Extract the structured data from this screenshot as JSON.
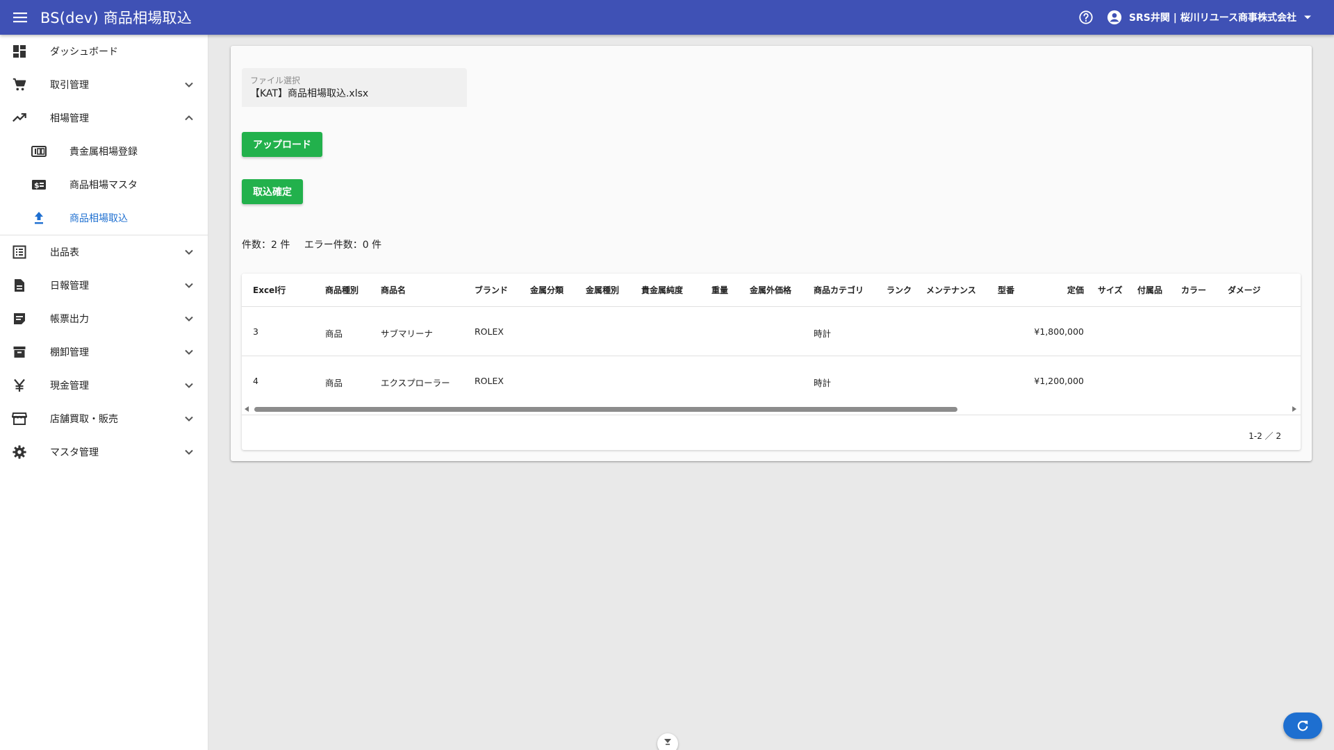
{
  "app": {
    "title": "BS(dev) 商品相場取込",
    "user": "SRS井関 | 桜川リユース商事株式会社",
    "colors": {
      "appbar": "#3f51b5",
      "accent_green": "#22b14c",
      "active_blue": "#1e6fd0"
    }
  },
  "sidebar": {
    "items": [
      {
        "label": "ダッシュボード",
        "icon": "dashboard-icon"
      },
      {
        "label": "取引管理",
        "icon": "cart-icon"
      },
      {
        "label": "相場管理",
        "icon": "trending-up-icon"
      },
      {
        "label": "出品表",
        "icon": "list-icon"
      },
      {
        "label": "日報管理",
        "icon": "document-icon"
      },
      {
        "label": "帳票出力",
        "icon": "report-icon"
      },
      {
        "label": "棚卸管理",
        "icon": "archive-icon"
      },
      {
        "label": "現金管理",
        "icon": "yen-icon"
      },
      {
        "label": "店舗買取・販売",
        "icon": "store-icon"
      },
      {
        "label": "マスタ管理",
        "icon": "gear-icon"
      }
    ],
    "sub_items": [
      {
        "label": "貴金属相場登録",
        "icon": "counter-100-icon"
      },
      {
        "label": "商品相場マスタ",
        "icon": "price-tag-icon"
      },
      {
        "label": "商品相場取込",
        "icon": "upload-icon"
      }
    ]
  },
  "main": {
    "file_label": "ファイル選択",
    "file_value": "【KAT】商品相場取込.xlsx",
    "upload_button": "アップロード",
    "confirm_button": "取込確定",
    "count_text": "件数：2 件",
    "error_count_text": "エラー件数：0 件"
  },
  "table": {
    "headers": [
      "Excel行",
      "商品種別",
      "商品名",
      "ブランド",
      "金属分類",
      "金属種別",
      "貴金属純度",
      "重量",
      "金属外価格",
      "商品カテゴリ",
      "ランク",
      "メンテナンス",
      "型番",
      "定価",
      "サイズ",
      "付属品",
      "カラー",
      "ダメージ"
    ],
    "rows": [
      [
        "3",
        "商品",
        "サブマリーナ",
        "ROLEX",
        "",
        "",
        "",
        "",
        "",
        "時計",
        "",
        "",
        "",
        "¥1,800,000",
        "",
        "",
        "",
        ""
      ],
      [
        "4",
        "商品",
        "エクスプローラー",
        "ROLEX",
        "",
        "",
        "",
        "",
        "",
        "時計",
        "",
        "",
        "",
        "¥1,200,000",
        "",
        "",
        "",
        ""
      ]
    ],
    "pagination": "1-2 ／ 2"
  }
}
